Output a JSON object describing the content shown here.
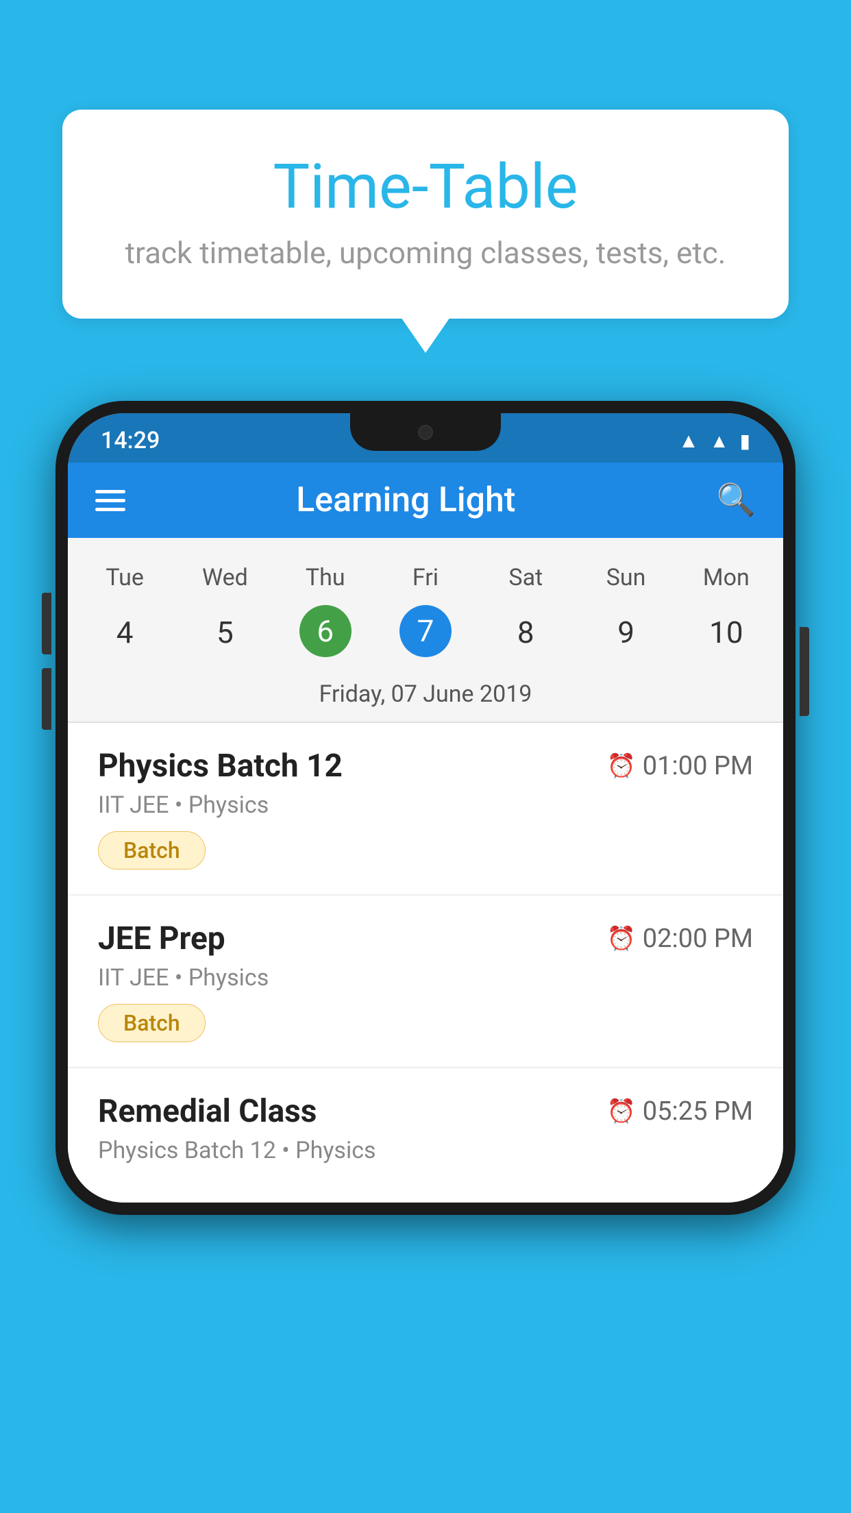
{
  "background_color": "#29b6e8",
  "bubble": {
    "title": "Time-Table",
    "subtitle": "track timetable, upcoming classes, tests, etc."
  },
  "phone": {
    "status_bar": {
      "time": "14:29"
    },
    "app_header": {
      "title": "Learning Light"
    },
    "calendar": {
      "day_names": [
        "Tue",
        "Wed",
        "Thu",
        "Fri",
        "Sat",
        "Sun",
        "Mon"
      ],
      "day_numbers": [
        "4",
        "5",
        "6",
        "7",
        "8",
        "9",
        "10"
      ],
      "today_index": 2,
      "selected_index": 3,
      "selected_date_label": "Friday, 07 June 2019"
    },
    "schedule": [
      {
        "title": "Physics Batch 12",
        "time": "01:00 PM",
        "subtitle": "IIT JEE • Physics",
        "tag": "Batch"
      },
      {
        "title": "JEE Prep",
        "time": "02:00 PM",
        "subtitle": "IIT JEE • Physics",
        "tag": "Batch"
      },
      {
        "title": "Remedial Class",
        "time": "05:25 PM",
        "subtitle": "Physics Batch 12 • Physics",
        "tag": ""
      }
    ]
  }
}
